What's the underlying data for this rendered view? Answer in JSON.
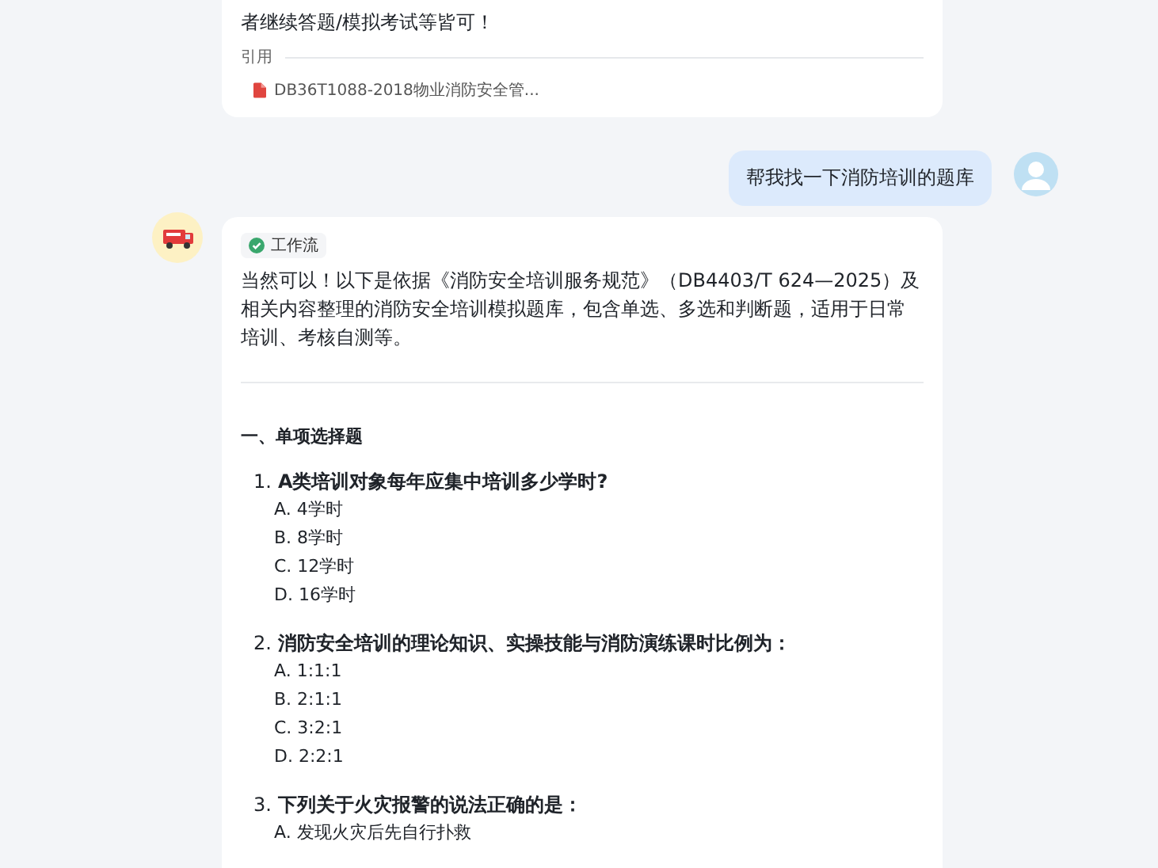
{
  "previous_answer": {
    "text": "者继续答题/模拟考试等皆可！",
    "citation_label": "引用",
    "citations": [
      {
        "title": "DB36T1088-2018物业消防安全管..."
      }
    ]
  },
  "user_message": {
    "text": "帮我找一下消防培训的题库"
  },
  "reply": {
    "workflow_tag": "工作流",
    "intro": "当然可以！以下是依据《消防安全培训服务规范》（DB4403/T 624—2025）及相关内容整理的消防安全培训模拟题库，包含单选、多选和判断题，适用于日常培训、考核自测等。",
    "sections": [
      {
        "heading": "一、单项选择题",
        "questions": [
          {
            "number": "1.",
            "text": "A类培训对象每年应集中培训多少学时?",
            "options": [
              "A. 4学时",
              "B. 8学时",
              "C. 12学时",
              "D. 16学时"
            ]
          },
          {
            "number": "2.",
            "text": "消防安全培训的理论知识、实操技能与消防演练课时比例为：",
            "options": [
              "A. 1:1:1",
              "B. 2:1:1",
              "C. 3:2:1",
              "D. 2:2:1"
            ]
          },
          {
            "number": "3.",
            "text": "下列关于火灾报警的说法正确的是：",
            "options": [
              "A. 发现火灾后先自行扑救"
            ]
          }
        ]
      }
    ]
  }
}
